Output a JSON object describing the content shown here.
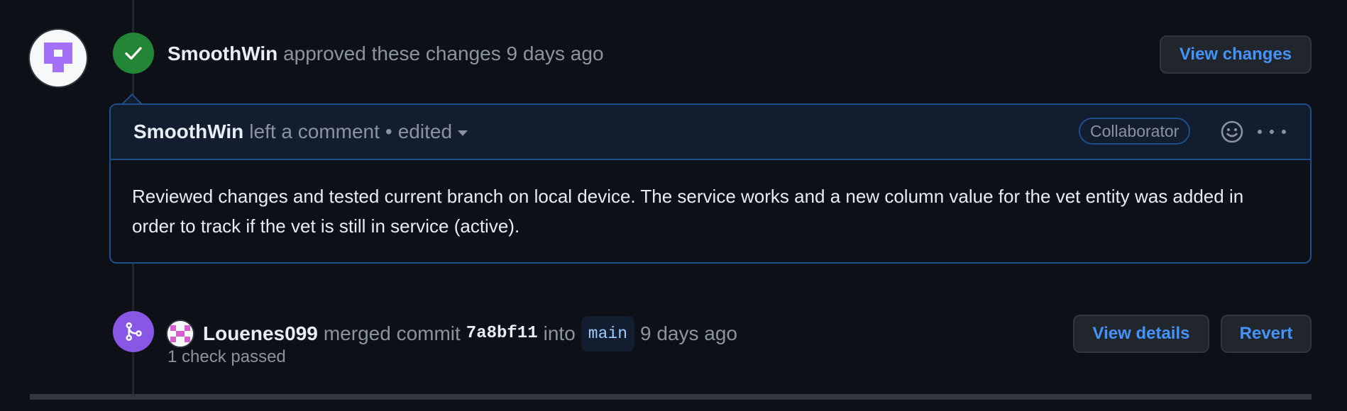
{
  "review": {
    "author": "SmoothWin",
    "action": "approved these changes",
    "time": "9 days ago",
    "view_changes_label": "View changes"
  },
  "comment": {
    "author": "SmoothWin",
    "action": "left a comment",
    "separator": "•",
    "edited_label": "edited",
    "role_badge": "Collaborator",
    "body": "Reviewed changes and tested current branch on local device. The service works and a new column value for the vet entity was added in order to track if the vet is still in service (active)."
  },
  "merge": {
    "author": "Louenes099",
    "action": "merged commit",
    "commit_sha": "7a8bf11",
    "into_label": "into",
    "branch": "main",
    "time": "9 days ago",
    "checks": "1 check passed",
    "view_details_label": "View details",
    "revert_label": "Revert"
  },
  "icons": {
    "approved": "check-icon",
    "merged": "git-merge-icon",
    "reaction": "smiley-icon",
    "more": "kebab-horizontal-icon",
    "dropdown": "triangle-down-icon"
  },
  "colors": {
    "background": "#0d1117",
    "approved_green": "#238636",
    "merged_purple": "#8957e5",
    "link_blue": "#4493f8",
    "comment_border": "#1f4e8c"
  }
}
